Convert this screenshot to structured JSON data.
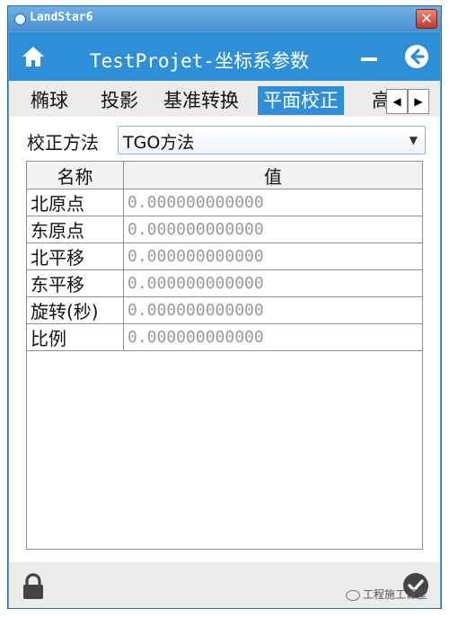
{
  "window": {
    "title": "LandStar6",
    "close_symbol": "✕"
  },
  "header": {
    "title": "TestProjet-坐标系参数",
    "home_icon": "home-icon",
    "minimize_icon": "minimize-icon",
    "back_icon": "back-arrow-icon"
  },
  "tabs": [
    {
      "label": "椭球",
      "active": false
    },
    {
      "label": "投影",
      "active": false
    },
    {
      "label": "基准转换",
      "active": false
    },
    {
      "label": "平面校正",
      "active": true
    },
    {
      "label": "高程",
      "active": false
    }
  ],
  "tab_scroll": {
    "left": "◀",
    "right": "▶"
  },
  "method": {
    "label": "校正方法",
    "value": "TGO方法"
  },
  "table": {
    "headers": [
      "名称",
      "值"
    ],
    "rows": [
      {
        "name": "北原点",
        "value": "0.000000000000"
      },
      {
        "name": "东原点",
        "value": "0.000000000000"
      },
      {
        "name": "北平移",
        "value": "0.000000000000"
      },
      {
        "name": "东平移",
        "value": "0.000000000000"
      },
      {
        "name": "旋转(秒)",
        "value": "0.000000000000"
      },
      {
        "name": "比例",
        "value": "0.000000000000"
      }
    ]
  },
  "footer": {
    "lock_icon": "lock-icon",
    "confirm_icon": "check-icon"
  },
  "watermark": "工程施工课堂",
  "colors": {
    "accent": "#2f8fd6",
    "titlebar": "#5a9fd6",
    "value_text": "#9a9a9a"
  }
}
